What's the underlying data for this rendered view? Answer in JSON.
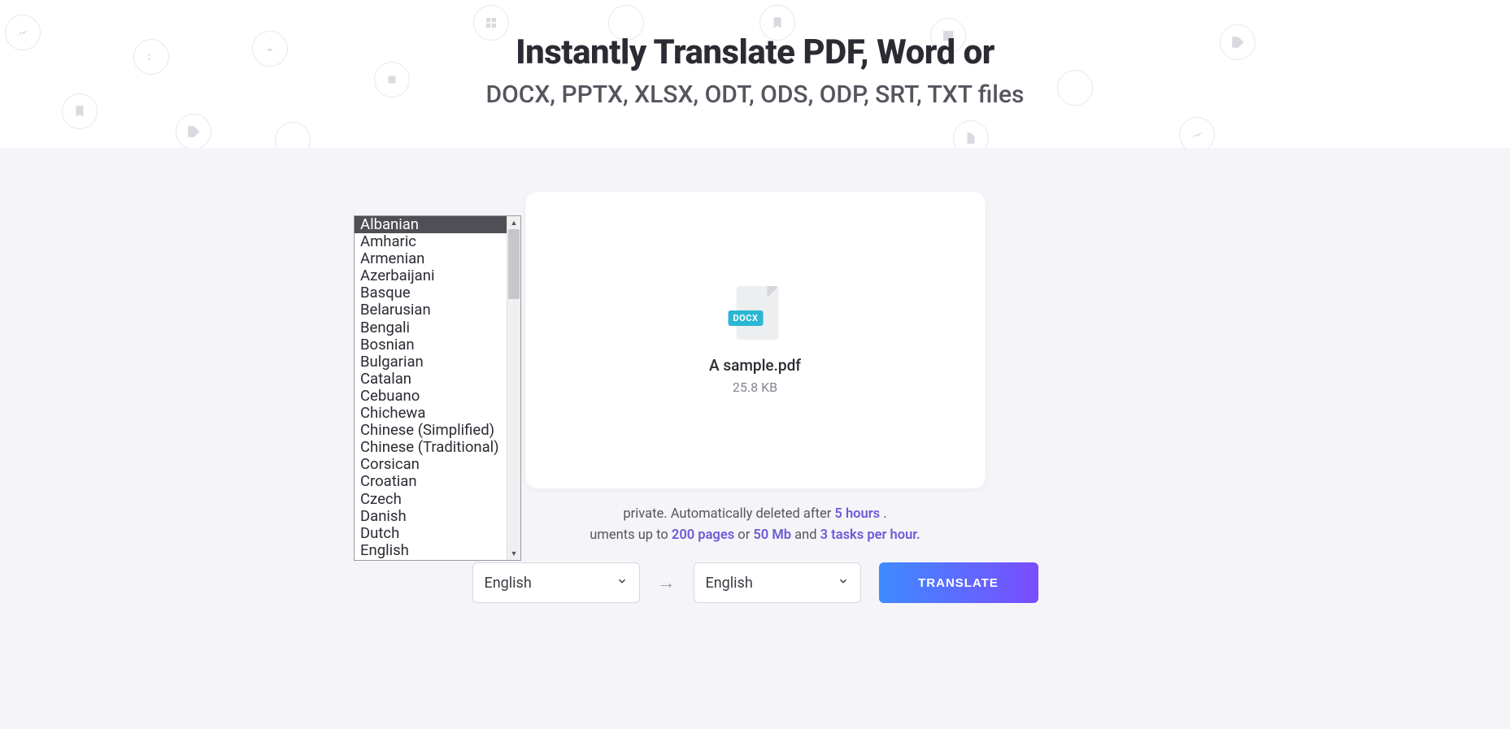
{
  "hero": {
    "title": "Instantly Translate PDF, Word or",
    "subtitle": "DOCX, PPTX, XLSX, ODT, ODS, ODP, SRT, TXT files"
  },
  "file": {
    "badge": "DOCX",
    "name": "A sample.pdf",
    "size": "25.8 KB"
  },
  "info": {
    "line1_mid": " private. Automatically deleted after ",
    "line1_hl": "5 hours",
    "line1_end": " .",
    "line2_pre": "uments up to ",
    "line2_hl1": "200 pages",
    "line2_mid1": " or ",
    "line2_hl2": "50 Mb",
    "line2_mid2": " and ",
    "line2_hl3": "3 tasks per hour.",
    "line2_end": ""
  },
  "controls": {
    "source_lang": "English",
    "target_lang": "English",
    "arrow": "→",
    "translate": "TRANSLATE"
  },
  "dropdown": {
    "items": [
      "Albanian",
      "Amharic",
      "Armenian",
      "Azerbaijani",
      "Basque",
      "Belarusian",
      "Bengali",
      "Bosnian",
      "Bulgarian",
      "Catalan",
      "Cebuano",
      "Chichewa",
      "Chinese (Simplified)",
      "Chinese (Traditional)",
      "Corsican",
      "Croatian",
      "Czech",
      "Danish",
      "Dutch",
      "English"
    ],
    "selected_index": 0
  },
  "chevron": "⌄"
}
